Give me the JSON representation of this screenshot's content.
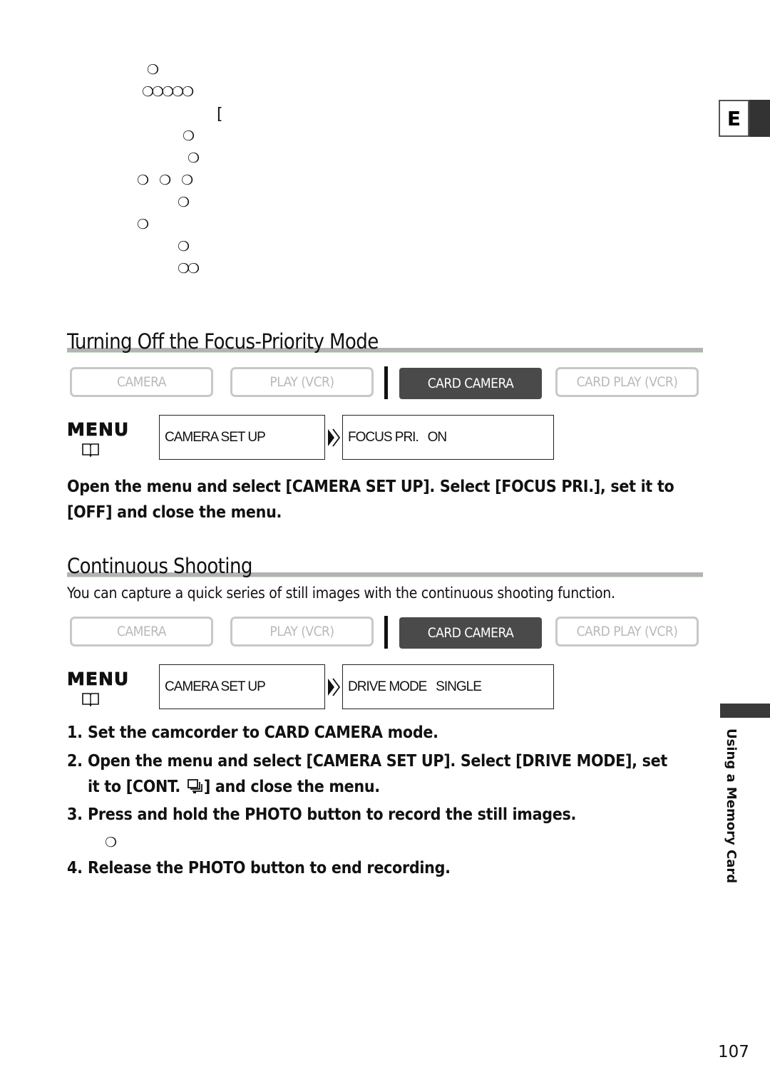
{
  "top_glyphs": {
    "icon": "shadowed-circle-bullet",
    "rows": [
      "❍",
      "❍❍❍❍❍",
      "[",
      "❍",
      "❍",
      "❍ ❍ ❍",
      "❍",
      "❍",
      "❍",
      "❍❍"
    ]
  },
  "language_tab": {
    "label": "E"
  },
  "sections": [
    {
      "title": "Turning Off the Focus-Priority Mode",
      "modes": [
        {
          "label": "CAMERA",
          "active": false
        },
        {
          "label": "PLAY (VCR)",
          "active": false
        },
        {
          "label": "CARD CAMERA",
          "active": true
        },
        {
          "label": "CARD PLAY (VCR)",
          "active": false
        }
      ],
      "menu": {
        "label": "MENU",
        "icon": "book-icon",
        "path": [
          "CAMERA SET UP",
          "FOCUS PRI.   ON"
        ]
      },
      "instruction": "Open the menu and select [CAMERA SET UP]. Select [FOCUS PRI.], set it to [OFF] and close the menu."
    },
    {
      "title": "Continuous Shooting",
      "intro": "You can capture a quick series of still images with the continuous shooting function.",
      "modes": [
        {
          "label": "CAMERA",
          "active": false
        },
        {
          "label": "PLAY (VCR)",
          "active": false
        },
        {
          "label": "CARD CAMERA",
          "active": true
        },
        {
          "label": "CARD PLAY (VCR)",
          "active": false
        }
      ],
      "menu": {
        "label": "MENU",
        "icon": "book-icon",
        "path": [
          "CAMERA SET UP",
          "DRIVE MODE   SINGLE"
        ]
      },
      "steps": [
        {
          "num": "1.",
          "text": "Set the camcorder to CARD CAMERA mode."
        },
        {
          "num": "2.",
          "line1": "Open the menu and select [CAMERA SET UP]. Select [DRIVE MODE], set",
          "line2_pre": "it to [CONT. ",
          "line2_icon": "continuous-shooting-icon",
          "line2_post": "] and close the menu."
        },
        {
          "num": "3.",
          "text": "Press and hold the PHOTO button to record the still images.",
          "sub_glyph": "❍"
        },
        {
          "num": "4.",
          "text": "Release the PHOTO button to end recording."
        }
      ]
    }
  ],
  "side_tab": {
    "label": "Using a Memory Card"
  },
  "page_number": "107"
}
